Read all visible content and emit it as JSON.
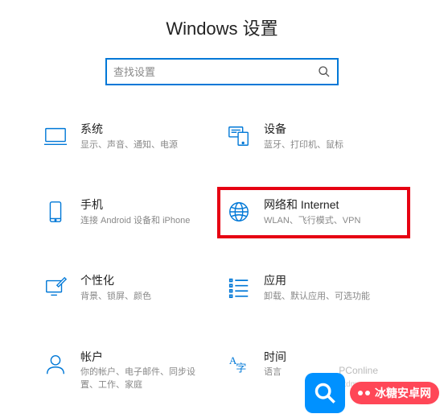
{
  "title": "Windows 设置",
  "search": {
    "placeholder": "查找设置"
  },
  "tiles": [
    {
      "id": "system",
      "title": "系统",
      "sub": "显示、声音、通知、电源"
    },
    {
      "id": "devices",
      "title": "设备",
      "sub": "蓝牙、打印机、鼠标"
    },
    {
      "id": "phone",
      "title": "手机",
      "sub": "连接 Android 设备和 iPhone"
    },
    {
      "id": "network",
      "title": "网络和 Internet",
      "sub": "WLAN、飞行模式、VPN",
      "highlight": true
    },
    {
      "id": "personalization",
      "title": "个性化",
      "sub": "背景、锁屏、颜色"
    },
    {
      "id": "apps",
      "title": "应用",
      "sub": "卸载、默认应用、可选功能"
    },
    {
      "id": "accounts",
      "title": "帐户",
      "sub": "你的帐户、电子邮件、同步设置、工作、家庭"
    },
    {
      "id": "time",
      "title": "时间",
      "sub": "语言"
    }
  ],
  "watermark": {
    "label": "PConline",
    "badge": "冰糖安卓网",
    "url": "www.btxtdmy.com"
  }
}
